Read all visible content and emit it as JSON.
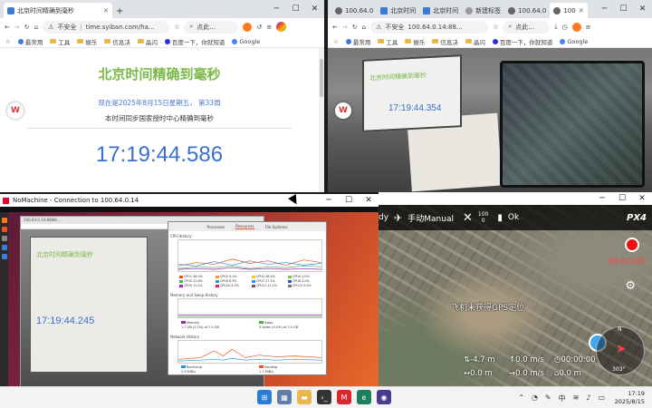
{
  "browser_left": {
    "tab_title": "北京时间精确到毫秒",
    "security_label": "不安全",
    "url": "time.syiban.com/ha...",
    "search_placeholder": "点此...",
    "bookmarks": [
      "最常用",
      "工具",
      "娱乐",
      "信息决",
      "晶闪",
      "百度一下，你就知道",
      "Google"
    ],
    "page": {
      "title": "北京时间精确到毫秒",
      "date_line": "现在是2025年8月15日星期五， 第33周",
      "subtitle": "本时间同步国家授时中心精确到毫秒",
      "clock": "17:19:44.586"
    }
  },
  "browser_right": {
    "tabs": [
      "100.64.0",
      "北京时间",
      "北京时间",
      "新建标签",
      "100.64.0",
      "100"
    ],
    "security_label": "不安全",
    "url": "100.64.0.14:88...",
    "search_placeholder": "点此...",
    "bookmarks": [
      "最常用",
      "工具",
      "娱乐",
      "信息决",
      "晶闪",
      "百度一下，你就知道",
      "Google"
    ],
    "camera": {
      "clock": "17:19:44.354",
      "screen_title": "北京时间精确到毫秒"
    }
  },
  "nomachine": {
    "title": "NoMachine - Connection to 100.64.0.14",
    "firefox_tab": "100.64.0.14:8888/...",
    "remote_cam": {
      "screen_title": "北京时间精确到毫秒",
      "clock": "17:19:44.245"
    },
    "sysmon": {
      "tabs": [
        "Processes",
        "Resources",
        "File Systems"
      ],
      "cpu_title": "CPU History",
      "cpu_legend": [
        "CPU1 36.0%",
        "CPU2 9.2%",
        "CPU3 38.4%",
        "CPU4 1.0%",
        "CPU5 22.8%",
        "CPU6 8.9%",
        "CPU7 27.1%",
        "CPU8 3.0%",
        "CPU9 11.1%",
        "CPU10 4.2%",
        "CPU11 11.1%",
        "CPU12 9.4%"
      ],
      "mem_title": "Memory and Swap History",
      "mem_label": "Memory",
      "mem_value": "1.7 GB (2.2%) of 7.5 GB",
      "swap_label": "Swap",
      "swap_value": "0 bytes (0.0%) of 2.0 GB",
      "net_title": "Network History",
      "recv_label": "Receiving",
      "recv_value": "2.9 MiB/s",
      "send_label": "Sending",
      "send_value": "1.7 MiB/s"
    }
  },
  "gcs": {
    "mode_prefix": "dy",
    "mode": "手动Manual",
    "battery": "100",
    "battery_sub": "0",
    "gps_status": "Ok",
    "logo": "PX4",
    "rec_time": "00:00:00",
    "warning": "飞机未获得GPS定位",
    "telemetry": [
      "-4.7 m",
      "0.0 m/s",
      "00:00:00",
      "0.0 m",
      "0.0 m/s",
      "0.0 m"
    ],
    "compass_heading": "303°",
    "compass_north": "N"
  },
  "taskbar": {
    "time": "17:19",
    "date": "2025/8/15",
    "lang": "中"
  },
  "colors": {
    "page_title_green": "#7ab848",
    "clock_blue": "#3a6fcf",
    "rec_red": "#e11111",
    "ubuntu_orange": "#e95420"
  }
}
